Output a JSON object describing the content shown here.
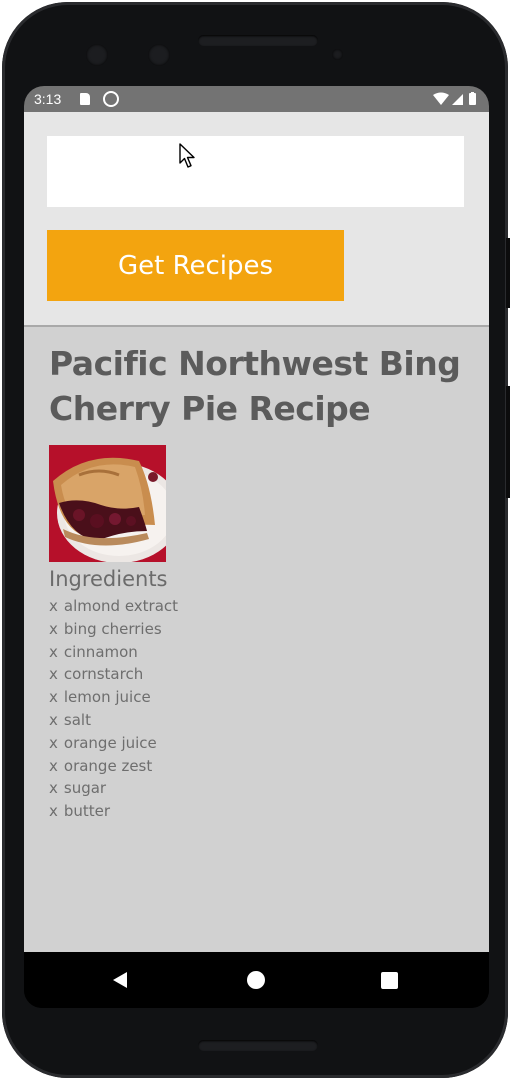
{
  "status_bar": {
    "time": "3:13",
    "icons": [
      "sd-card-icon",
      "sync-icon",
      "wifi-icon",
      "signal-icon",
      "battery-icon"
    ]
  },
  "search": {
    "value": "",
    "placeholder": ""
  },
  "get_recipes_label": "Get Recipes",
  "recipe": {
    "title": "Pacific Northwest Bing Cherry Pie Recipe",
    "ingredients_heading": "Ingredients",
    "ingredient_marker": "x",
    "ingredients": [
      "almond extract",
      "bing cherries",
      "cinnamon",
      "cornstarch",
      "lemon juice",
      "salt",
      "orange juice",
      "orange zest",
      "sugar",
      "butter"
    ]
  },
  "nav": {
    "icons": [
      "back-icon",
      "home-icon",
      "recents-icon"
    ]
  },
  "colors": {
    "accent": "#f3a40f",
    "top_panel_bg": "#e6e6e6",
    "recipe_panel_bg": "#d1d1d1",
    "title_text": "#5b5b5b",
    "status_bar_bg": "#737373"
  }
}
